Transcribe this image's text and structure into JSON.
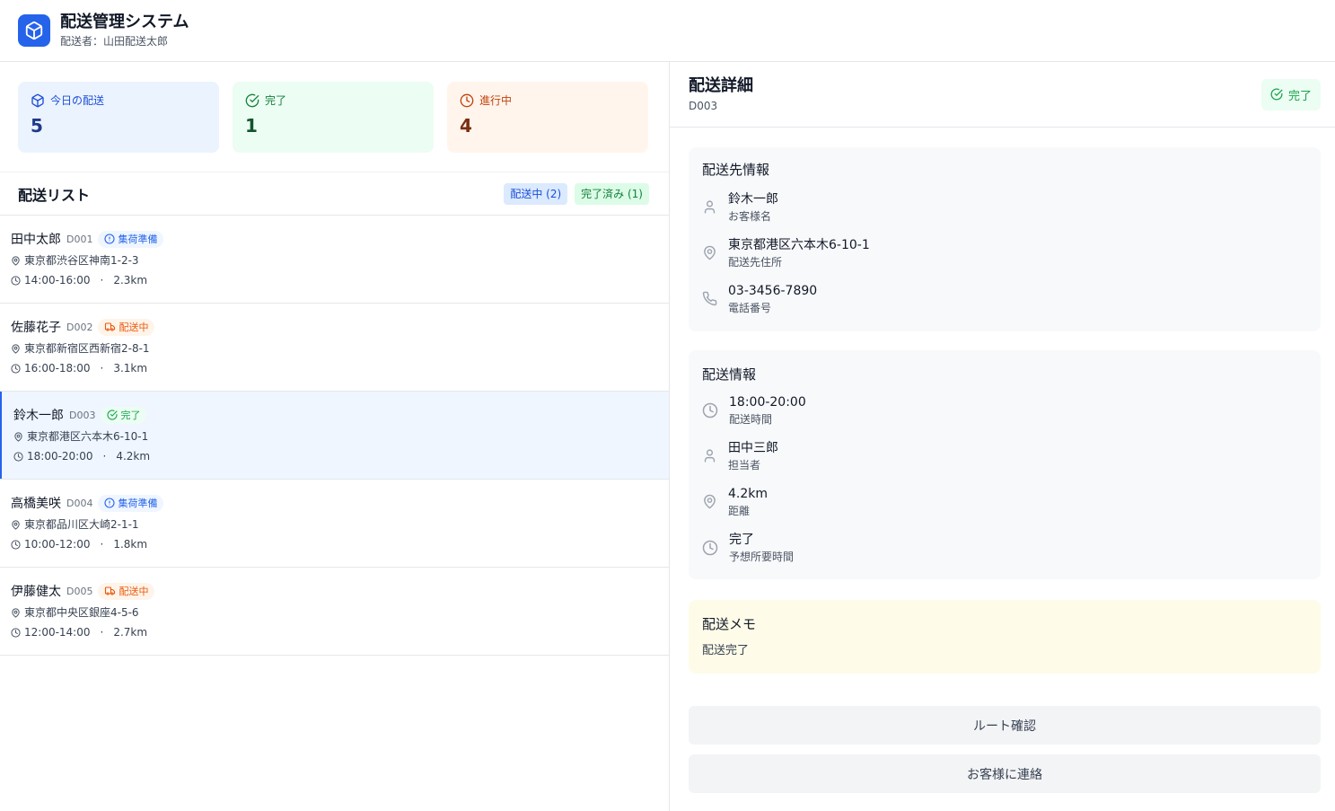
{
  "header": {
    "title": "配送管理システム",
    "subtitle": "配送者：山田配送太郎"
  },
  "stats": [
    {
      "label": "今日の配送",
      "value": "5"
    },
    {
      "label": "完了",
      "value": "1"
    },
    {
      "label": "進行中",
      "value": "4"
    }
  ],
  "list": {
    "title": "配送リスト",
    "filters": [
      "配送中 (2)",
      "完了済み (1)"
    ],
    "items": [
      {
        "name": "田中太郎",
        "id": "D001",
        "status": "集荷準備",
        "address": "東京都渋谷区神南1-2-3",
        "time": "14:00-16:00",
        "distance": "2.3km"
      },
      {
        "name": "佐藤花子",
        "id": "D002",
        "status": "配送中",
        "address": "東京都新宿区西新宿2-8-1",
        "time": "16:00-18:00",
        "distance": "3.1km"
      },
      {
        "name": "鈴木一郎",
        "id": "D003",
        "status": "完了",
        "address": "東京都港区六本木6-10-1",
        "time": "18:00-20:00",
        "distance": "4.2km"
      },
      {
        "name": "高橋美咲",
        "id": "D004",
        "status": "集荷準備",
        "address": "東京都品川区大崎2-1-1",
        "time": "10:00-12:00",
        "distance": "1.8km"
      },
      {
        "name": "伊藤健太",
        "id": "D005",
        "status": "配送中",
        "address": "東京都中央区銀座4-5-6",
        "time": "12:00-14:00",
        "distance": "2.7km"
      }
    ]
  },
  "detail": {
    "title": "配送詳細",
    "id": "D003",
    "status": "完了",
    "destination": {
      "title": "配送先情報",
      "rows": [
        {
          "value": "鈴木一郎",
          "label": "お客様名"
        },
        {
          "value": "東京都港区六本木6-10-1",
          "label": "配送先住所"
        },
        {
          "value": "03-3456-7890",
          "label": "電話番号"
        }
      ]
    },
    "delivery": {
      "title": "配送情報",
      "rows": [
        {
          "value": "18:00-20:00",
          "label": "配送時間"
        },
        {
          "value": "田中三郎",
          "label": "担当者"
        },
        {
          "value": "4.2km",
          "label": "距離"
        },
        {
          "value": "完了",
          "label": "予想所要時間"
        }
      ]
    },
    "memo": {
      "title": "配送メモ",
      "text": "配送完了"
    },
    "buttons": {
      "route": "ルート確認",
      "contact": "お客様に連絡"
    }
  }
}
